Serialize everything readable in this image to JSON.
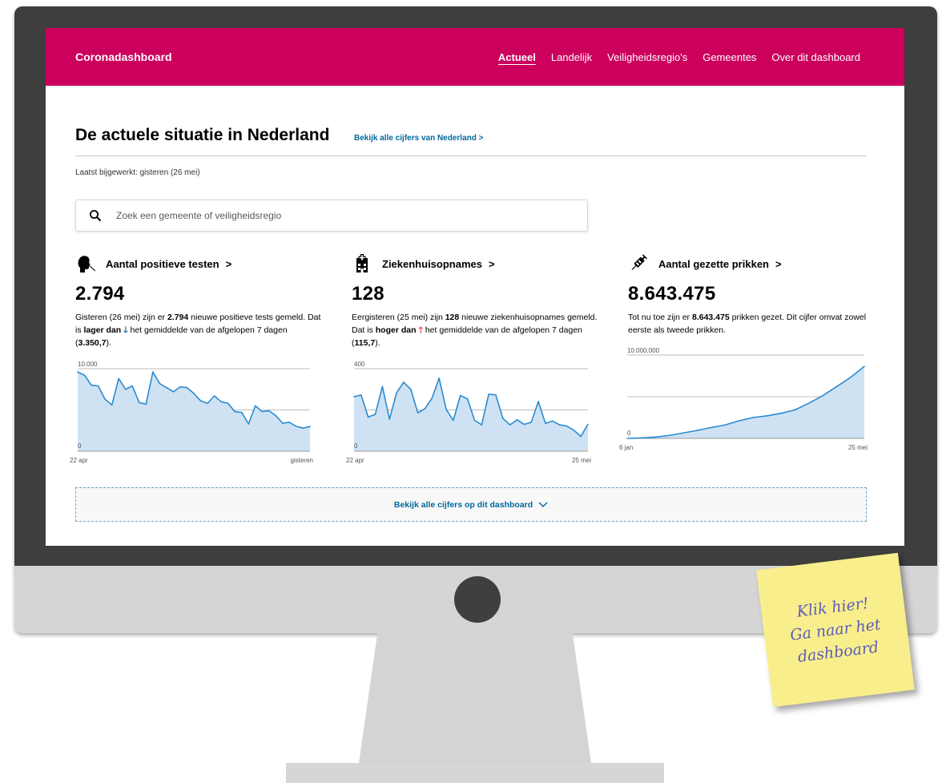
{
  "header": {
    "brand": "Coronadashboard",
    "nav": [
      "Actueel",
      "Landelijk",
      "Veiligheidsregio's",
      "Gemeentes",
      "Over dit dashboard"
    ],
    "active_nav": "Actueel"
  },
  "main": {
    "title": "De actuele situatie in Nederland",
    "see_all_link": "Bekijk alle cijfers van Nederland >",
    "updated": "Laatst bijgewerkt: gisteren (26 mei)",
    "search_placeholder": "Zoek een gemeente of veiligheidsregio",
    "more_button": "Bekijk alle cijfers op dit dashboard"
  },
  "cards": [
    {
      "title": "Aantal positieve testen",
      "value": "2.794",
      "desc_1": "Gisteren (26 mei) zijn er ",
      "desc_b1": "2.794",
      "desc_2": " nieuwe positieve tests gemeld. Dat is ",
      "desc_b2": "lager dan",
      "arrow": "🡓",
      "desc_3": " het gemiddelde van de afgelopen 7 dagen (",
      "desc_b3": "3.350,7",
      "desc_4": ")."
    },
    {
      "title": "Ziekenhuisopnames",
      "value": "128",
      "desc_1": "Eergisteren (25 mei) zijn ",
      "desc_b1": "128",
      "desc_2": " nieuwe ziekenhuisopnames gemeld. Dat is ",
      "desc_b2": "hoger dan",
      "arrow": "🡑",
      "desc_3": " het gemiddelde van de afgelopen 7 dagen (",
      "desc_b3": "115,7",
      "desc_4": ")."
    },
    {
      "title": "Aantal gezette prikken",
      "value": "8.643.475",
      "desc_1": "Tot nu toe zijn er ",
      "desc_b1": "8.643.475",
      "desc_2": " prikken gezet. Dit cijfer omvat zowel eerste als tweede prikken."
    }
  ],
  "chart_data": [
    {
      "type": "area",
      "ymax_label": "10.000",
      "ymin_label": "0",
      "ylim": [
        0,
        10000
      ],
      "x_start": "22 apr",
      "x_end": "gisteren",
      "values": [
        9600,
        9200,
        8000,
        7900,
        6300,
        5600,
        8800,
        7500,
        7900,
        5900,
        5700,
        9600,
        8200,
        7700,
        7200,
        7800,
        7700,
        7000,
        6100,
        5800,
        6700,
        6000,
        5800,
        4800,
        4700,
        3300,
        5500,
        4800,
        4900,
        4300,
        3400,
        3500,
        3000,
        2800,
        2990
      ]
    },
    {
      "type": "area",
      "ymax_label": "400",
      "ymin_label": "0",
      "ylim": [
        0,
        400
      ],
      "x_start": "22 apr",
      "x_end": "25 mei",
      "values": [
        264,
        272,
        165,
        179,
        314,
        155,
        283,
        334,
        300,
        186,
        206,
        257,
        354,
        203,
        149,
        270,
        254,
        150,
        128,
        276,
        273,
        159,
        128,
        152,
        130,
        140,
        241,
        135,
        146,
        128,
        122,
        102,
        72,
        130
      ]
    },
    {
      "type": "area",
      "ymax_label": "10.000.000",
      "ymin_label": "0",
      "ylim": [
        0,
        10000000
      ],
      "x_start": "6 jan",
      "x_end": "25 mei",
      "values": [
        0,
        50000,
        150000,
        350000,
        650000,
        950000,
        1300000,
        1600000,
        2100000,
        2500000,
        2700000,
        3000000,
        3400000,
        4200000,
        5100000,
        6200000,
        7300000,
        8643475
      ]
    }
  ],
  "note": {
    "lines": [
      "Klik hier!",
      "Ga naar het",
      "dashboard"
    ]
  }
}
